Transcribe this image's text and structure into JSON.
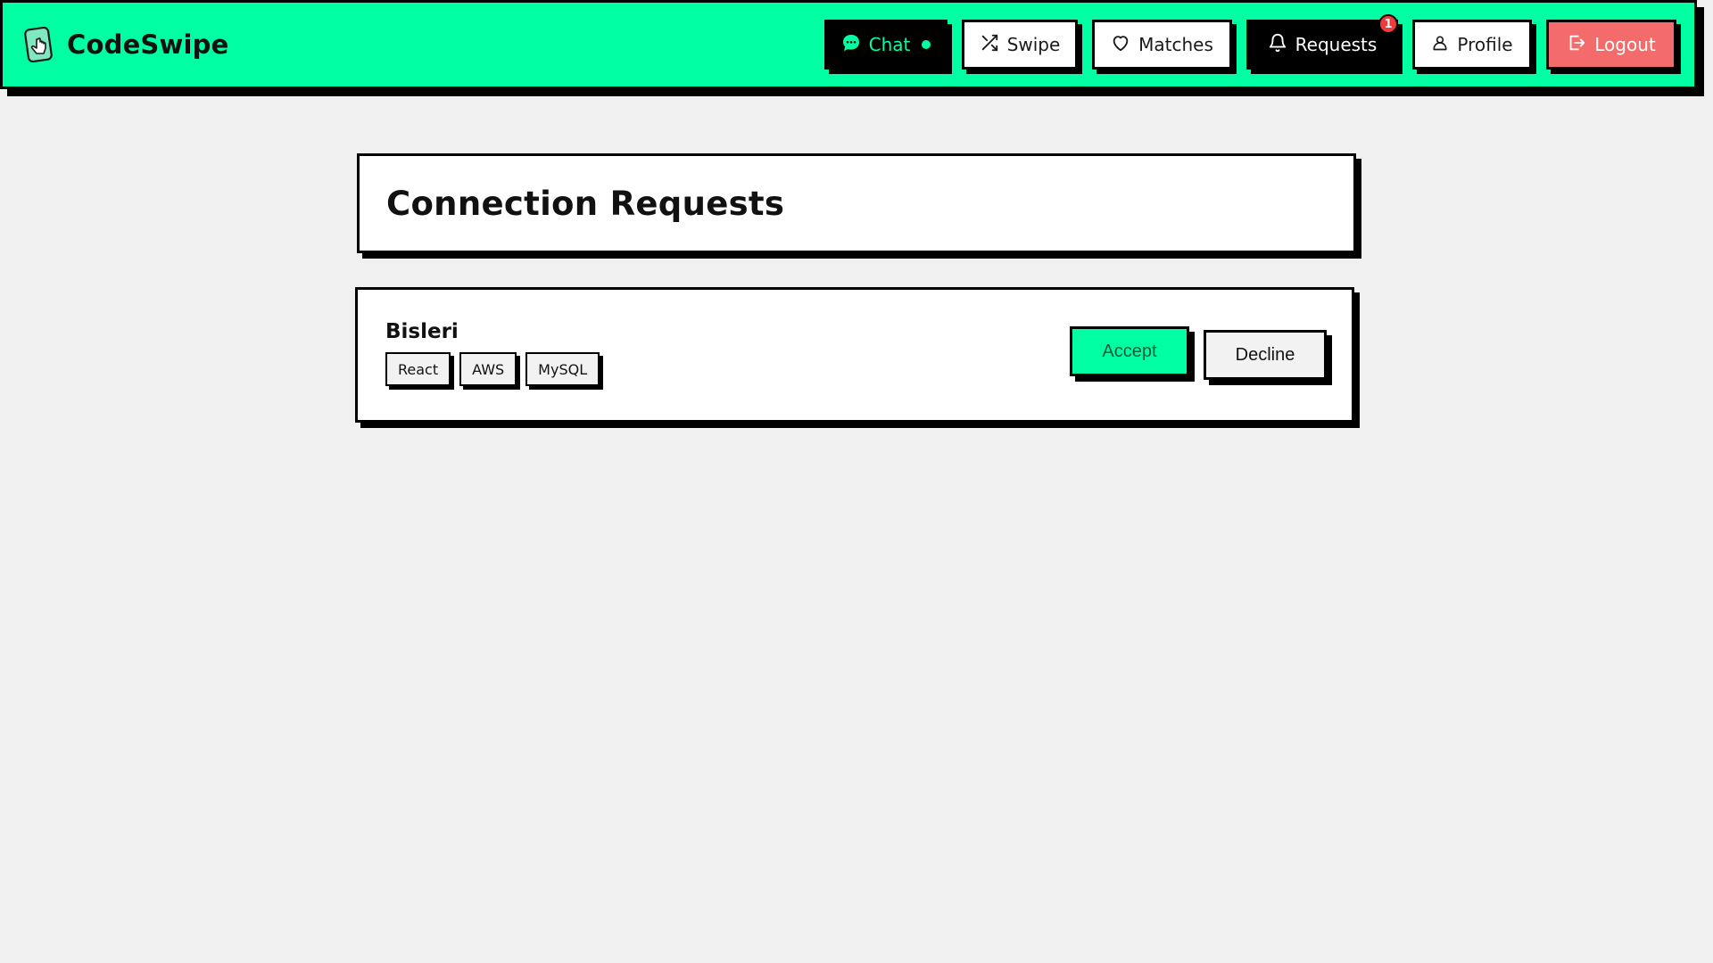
{
  "app": {
    "brand_name": "CodeSwipe",
    "logo_icon": "phone-tap-icon"
  },
  "nav": {
    "items": [
      {
        "label": "Chat",
        "icon": "chat-bubble-icon",
        "indicator": "online-dot"
      },
      {
        "label": "Swipe",
        "icon": "shuffle-icon"
      },
      {
        "label": "Matches",
        "icon": "heart-icon"
      },
      {
        "label": "Requests",
        "icon": "bell-icon",
        "badge": "1"
      },
      {
        "label": "Profile",
        "icon": "user-icon"
      },
      {
        "label": "Logout",
        "icon": "logout-icon"
      }
    ]
  },
  "page": {
    "title": "Connection Requests"
  },
  "requests": [
    {
      "name": "Bisleri",
      "skills": [
        "React",
        "AWS",
        "MySQL"
      ],
      "accept_label": "Accept",
      "decline_label": "Decline"
    }
  ],
  "colors": {
    "accent": "#00ffa3",
    "danger": "#f46b6b",
    "badge": "#ef3b3b",
    "background": "#f0f0f0"
  }
}
